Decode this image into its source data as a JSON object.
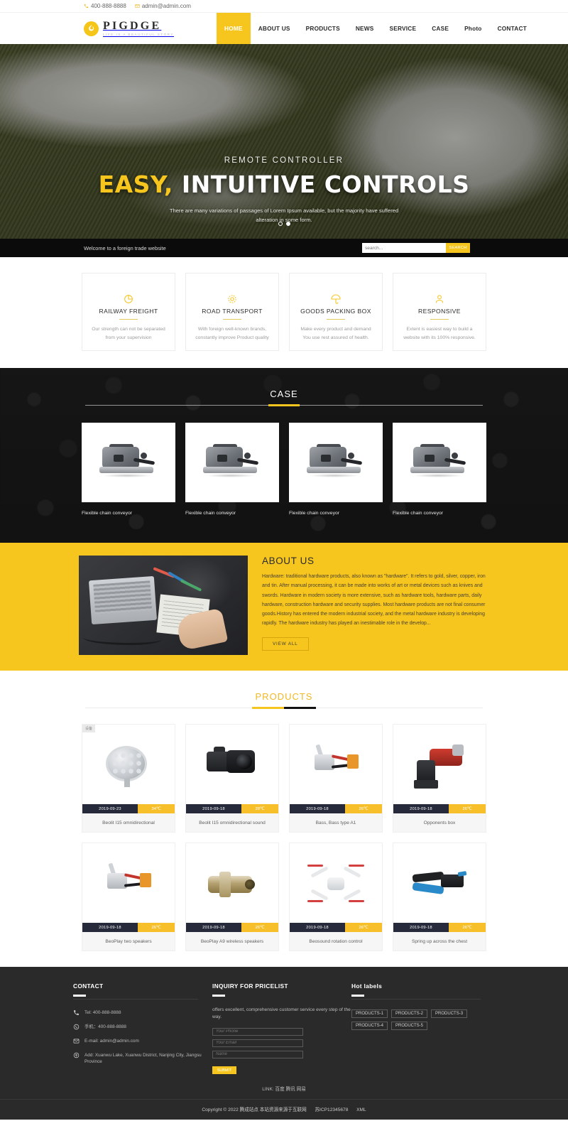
{
  "topbar": {
    "phone": "400-888-8888",
    "email": "admin@admin.com",
    "phone_icon": "phone-icon",
    "email_icon": "mail-icon"
  },
  "brand": {
    "name": "PIGDGE",
    "tagline": "LIFE IS A BEAUTIFUL STORY",
    "logo_icon": "flame-logo-icon",
    "accent": "#f7c61e"
  },
  "nav": {
    "items": [
      {
        "label": "HOME",
        "active": true
      },
      {
        "label": "ABOUT US",
        "active": false
      },
      {
        "label": "PRODUCTS",
        "active": false
      },
      {
        "label": "NEWS",
        "active": false
      },
      {
        "label": "SERVICE",
        "active": false
      },
      {
        "label": "CASE",
        "active": false
      },
      {
        "label": "Photo",
        "active": false
      },
      {
        "label": "CONTACT",
        "active": false
      }
    ]
  },
  "hero": {
    "kicker": "REMOTE CONTROLLER",
    "title_highlight": "EASY,",
    "title_rest": "INTUITIVE CONTROLS",
    "description": "There are many variations of passages of Lorem Ipsum available, but the majority have suffered alteration in some form.",
    "slides": 2,
    "active_slide": 2
  },
  "strip": {
    "welcome": "Welcome to a foreign trade website",
    "search_placeholder": "search...",
    "search_value": "",
    "search_button": "SEARCH"
  },
  "services": {
    "cards": [
      {
        "icon": "pie-chart-icon",
        "title": "RAILWAY FREIGHT",
        "desc": "Our strength can not be separated from your supervision"
      },
      {
        "icon": "gear-icon",
        "title": "ROAD TRANSPORT",
        "desc": "With foreign well-known brands, constantly improve Product quality"
      },
      {
        "icon": "umbrella-icon",
        "title": "GOODS PACKING BOX",
        "desc": "Make every product and demand You use rest assured of health."
      },
      {
        "icon": "user-icon",
        "title": "RESPONSIVE",
        "desc": "Extent is easiest way to build a website with its 100% responsive."
      }
    ]
  },
  "case": {
    "title": "CASE",
    "items": [
      {
        "caption": "Flexible chain conveyor"
      },
      {
        "caption": "Flexible chain conveyor"
      },
      {
        "caption": "Flexible chain conveyor"
      },
      {
        "caption": "Flexible chain conveyor"
      }
    ]
  },
  "about": {
    "title": "ABOUT US",
    "text": "Hardware: traditional hardware products, also known as \"hardware\". It refers to gold, silver, copper, iron and tin. After manual processing, it can be made into works of art or metal devices such as knives and swords. Hardware in modern society is more extensive, such as hardware tools, hardware parts, daily hardware, construction hardware and security supplies. Most hardware products are not final consumer goods.History has entered the modern industrial society, and the metal hardware industry is developing rapidly. The hardware industry has played an inestimable role in the develop...",
    "button": "VIEW ALL",
    "image_alt": "desk-with-laptop-and-notebook"
  },
  "products": {
    "title": "PRODUCTS",
    "items": [
      {
        "name": "Beolit I15 omnidirectional",
        "date": "2019-09-23",
        "temp": "34℃",
        "badge": "设备",
        "illustration": "led-floodlight"
      },
      {
        "name": "Beolit I15 omnidirectional sound",
        "date": "2019-09-18",
        "temp": "28℃",
        "badge": "",
        "illustration": "dslr-camera"
      },
      {
        "name": "Bass, Bass type A1",
        "date": "2019-09-18",
        "temp": "26℃",
        "badge": "",
        "illustration": "wire-connector"
      },
      {
        "name": "Opponents box",
        "date": "2019-09-18",
        "temp": "26℃",
        "badge": "",
        "illustration": "cordless-rebar-tier"
      },
      {
        "name": "BeoPlay two speakers",
        "date": "2019-09-18",
        "temp": "26℃",
        "badge": "",
        "illustration": "wire-connector"
      },
      {
        "name": "BeoPlay A9 wireless speakers",
        "date": "2019-09-18",
        "temp": "26℃",
        "badge": "",
        "illustration": "brass-pipe-fitting"
      },
      {
        "name": "Beosound rotation control",
        "date": "2019-09-18",
        "temp": "26℃",
        "badge": "",
        "illustration": "quadcopter-drone"
      },
      {
        "name": "Spring up across the chest",
        "date": "2019-09-18",
        "temp": "26℃",
        "badge": "",
        "illustration": "crimping-tool"
      }
    ]
  },
  "footer": {
    "contact": {
      "heading": "CONTACT",
      "items": [
        {
          "icon": "phone-icon",
          "text": "Tel:  400-888-8888"
        },
        {
          "icon": "whatsapp-icon",
          "text": "手机：400-888-8888"
        },
        {
          "icon": "mail-icon",
          "text": "E-mail: admin@admin.com"
        },
        {
          "icon": "location-pin-icon",
          "text": "Add:  Xuanwu Lake, Xuanwu District, Nanjing City, Jiangsu Province"
        }
      ]
    },
    "inquiry": {
      "heading": "INQUIRY FOR PRICELIST",
      "text": "offers excellent, comprehensive customer service every step of the way.",
      "fields": [
        {
          "placeholder": "Your Phone",
          "value": ""
        },
        {
          "placeholder": "Your Email",
          "value": ""
        },
        {
          "placeholder": "Name",
          "value": ""
        }
      ],
      "submit": "SUBMIT"
    },
    "labels": {
      "heading": "Hot labels",
      "tags": [
        "PRODUCTS-1",
        "PRODUCTS-2",
        "PRODUCTS-3",
        "PRODUCTS-4",
        "PRODUCTS-5"
      ]
    },
    "links": {
      "prefix": "LINK:",
      "items": [
        "百度",
        "腾讯",
        "网易"
      ]
    },
    "copyright": {
      "text": "Copyright © 2022 腾成站点 本站资源来源于互联网",
      "icp": "苏ICP12345678",
      "xml": "XML"
    }
  }
}
